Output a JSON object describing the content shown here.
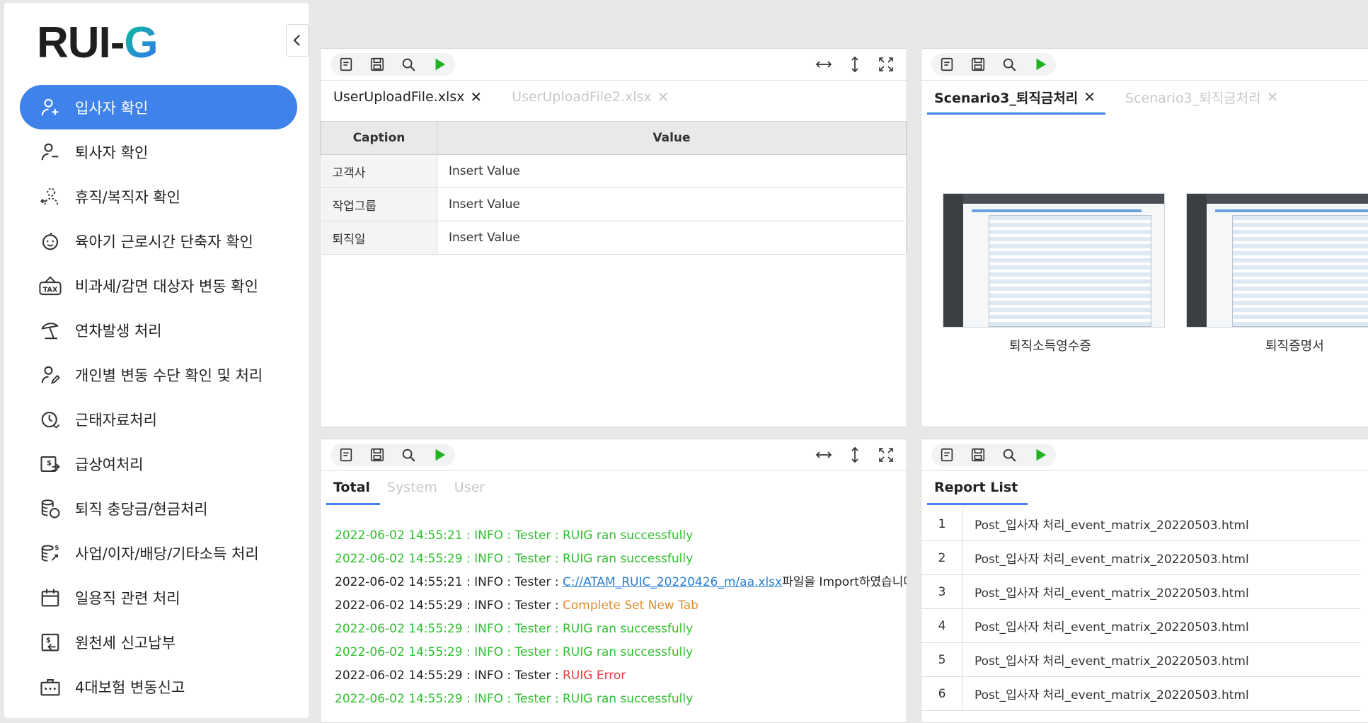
{
  "app": {
    "logo_prefix": "RUI-",
    "logo_accent": "G"
  },
  "colors": {
    "accent": "#3f82ea",
    "success": "#2fbf2f",
    "error": "#e33b3b",
    "warning": "#e08d2b",
    "link": "#2a7ed3"
  },
  "sidebar": {
    "items": [
      {
        "label": "입사자 확인",
        "icon": "user-add-icon",
        "active": true
      },
      {
        "label": "퇴사자 확인",
        "icon": "user-remove-icon"
      },
      {
        "label": "휴직/복직자 확인",
        "icon": "user-return-icon"
      },
      {
        "label": "육아기 근로시간 단축자 확인",
        "icon": "baby-icon"
      },
      {
        "label": "비과세/감면 대상자 변동 확인",
        "icon": "tax-icon"
      },
      {
        "label": "연차발생 처리",
        "icon": "beach-umbrella-icon"
      },
      {
        "label": "개인별 변동 수단 확인 및 처리",
        "icon": "user-edit-icon"
      },
      {
        "label": "근태자료처리",
        "icon": "clock-icon"
      },
      {
        "label": "급상여처리",
        "icon": "money-transfer-icon"
      },
      {
        "label": "퇴직 충당금/현금처리",
        "icon": "coins-icon"
      },
      {
        "label": "사업/이자/배당/기타소득 처리",
        "icon": "income-icon"
      },
      {
        "label": "일용직 관련 처리",
        "icon": "calendar-icon"
      },
      {
        "label": "원천세 신고납부",
        "icon": "tax-return-icon"
      },
      {
        "label": "4대보험 변동신고",
        "icon": "insurance-icon"
      }
    ]
  },
  "panel_upload": {
    "tabs": [
      {
        "label": "UserUploadFile.xlsx",
        "active": true
      },
      {
        "label": "UserUploadFile2.xlsx",
        "active": false
      }
    ],
    "table": {
      "headers": [
        "Caption",
        "Value"
      ],
      "rows": [
        [
          "고객사",
          "Insert Value"
        ],
        [
          "작업그룹",
          "Insert Value"
        ],
        [
          "퇴직일",
          "Insert Value"
        ]
      ]
    }
  },
  "panel_scenario": {
    "tabs": [
      {
        "label": "Scenario3_퇴직금처리",
        "active": true
      },
      {
        "label": "Scenario3_퇴직금처리",
        "active": false
      }
    ],
    "thumbnails": [
      {
        "caption": "퇴직소득영수증"
      },
      {
        "caption": "퇴직증명서"
      }
    ]
  },
  "panel_log": {
    "tabs": [
      {
        "label": "Total",
        "active": true
      },
      {
        "label": "System"
      },
      {
        "label": "User"
      }
    ],
    "entries": [
      {
        "prefix": "2022-06-02 14:55:21 : INFO : Tester : ",
        "message": "RUIG ran successfully",
        "status": "success"
      },
      {
        "prefix": "2022-06-02 14:55:29 : INFO : Tester : ",
        "message": "RUIG ran successfully",
        "status": "success"
      },
      {
        "prefix": "2022-06-02 14:55:21 : INFO : Tester : ",
        "path": "C://ATAM_RUIC_20220426_m/aa.xlsx",
        "suffix": "파일을 Import하였습니다.",
        "status": "info"
      },
      {
        "prefix": "2022-06-02 14:55:29 : INFO : Tester : ",
        "message": "Complete Set New Tab",
        "status": "warning"
      },
      {
        "prefix": "2022-06-02 14:55:29 : INFO : Tester : ",
        "message": "RUIG ran successfully",
        "status": "success"
      },
      {
        "prefix": "2022-06-02 14:55:29 : INFO : Tester : ",
        "message": "RUIG ran successfully",
        "status": "success"
      },
      {
        "prefix": "2022-06-02 14:55:29 : INFO : Tester : ",
        "message": "RUIG Error",
        "status": "error"
      },
      {
        "prefix": "2022-06-02 14:55:29 : INFO : Tester : ",
        "message": "RUIG ran successfully",
        "status": "success"
      }
    ]
  },
  "panel_report": {
    "tabs": [
      {
        "label": "Report List",
        "active": true
      }
    ],
    "rows": [
      {
        "no": "1",
        "file": "Post_입사자 처리_event_matrix_20220503.html"
      },
      {
        "no": "2",
        "file": "Post_입사자 처리_event_matrix_20220503.html"
      },
      {
        "no": "3",
        "file": "Post_입사자 처리_event_matrix_20220503.html"
      },
      {
        "no": "4",
        "file": "Post_입사자 처리_event_matrix_20220503.html"
      },
      {
        "no": "5",
        "file": "Post_입사자 처리_event_matrix_20220503.html"
      },
      {
        "no": "6",
        "file": "Post_입사자 처리_event_matrix_20220503.html"
      }
    ]
  }
}
